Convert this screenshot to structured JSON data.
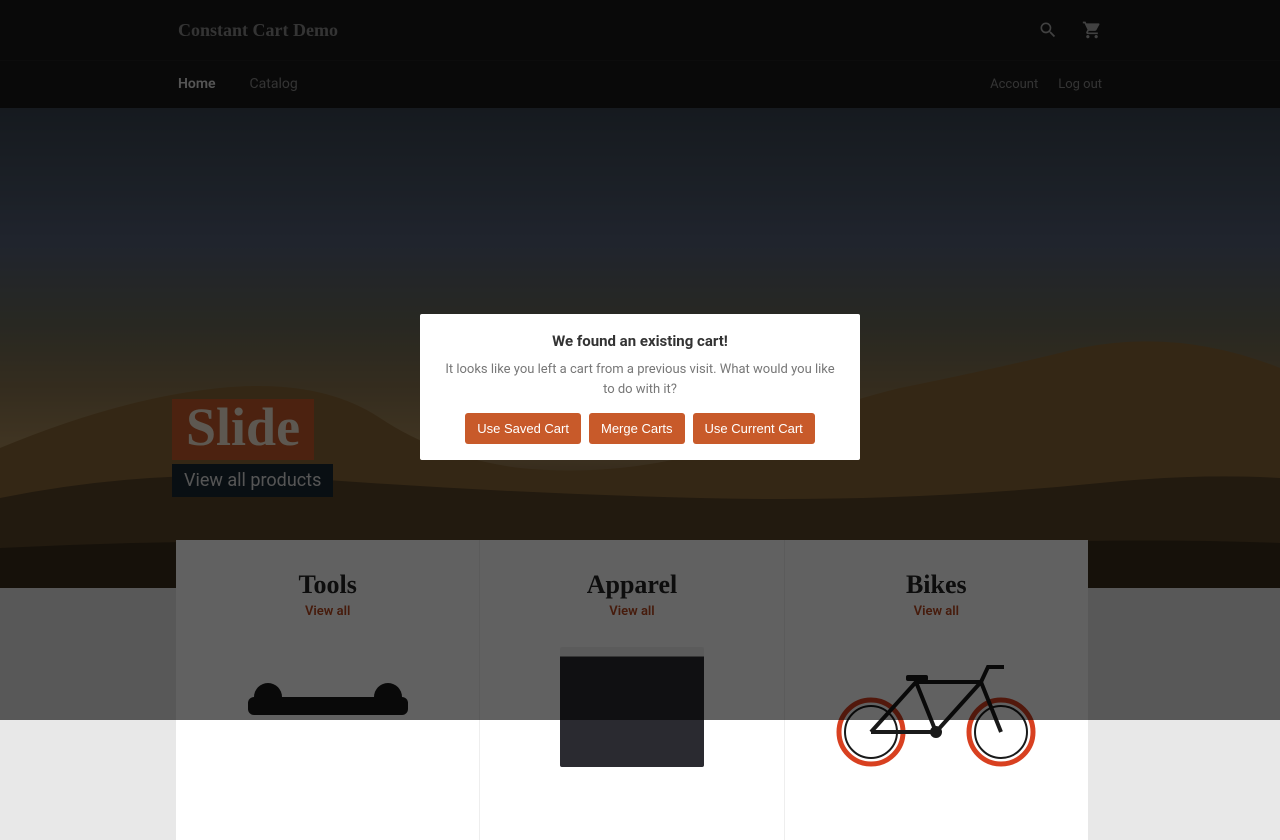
{
  "header": {
    "site_title": "Constant Cart Demo"
  },
  "nav": {
    "items": [
      {
        "label": "Home",
        "active": true
      },
      {
        "label": "Catalog",
        "active": false
      }
    ],
    "account": "Account",
    "logout": "Log out"
  },
  "hero": {
    "slide_label": "Slide",
    "view_all": "View all products"
  },
  "categories": [
    {
      "title": "Tools",
      "view_all": "View all"
    },
    {
      "title": "Apparel",
      "view_all": "View all"
    },
    {
      "title": "Bikes",
      "view_all": "View all"
    }
  ],
  "modal": {
    "title": "We found an existing cart!",
    "message": "It looks like you left a cart from a previous visit. What would you like to do with it?",
    "buttons": {
      "use_saved": "Use Saved Cart",
      "merge": "Merge Carts",
      "use_current": "Use Current Cart"
    }
  },
  "colors": {
    "accent": "#c85a2a"
  }
}
